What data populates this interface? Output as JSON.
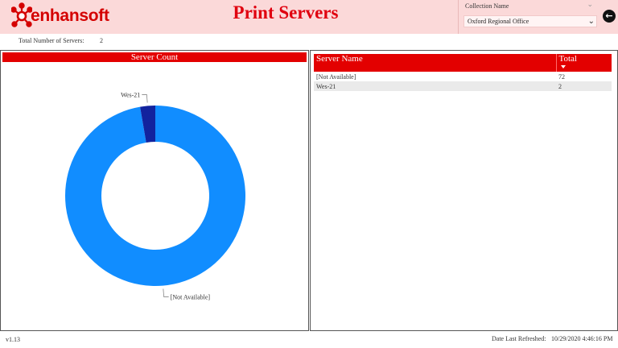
{
  "header": {
    "logo_text": "enhansoft",
    "title": "Print Servers",
    "brand_color": "#e30000"
  },
  "slicer": {
    "label": "Collection Name",
    "value": "Oxford Regional Office",
    "chevron_icon": "chevron-down-icon"
  },
  "back_button": {
    "icon": "arrow-left-icon"
  },
  "summary": {
    "total_label": "Total Number of Servers:",
    "total_value": "2"
  },
  "chart_data": {
    "type": "pie",
    "title": "Server Count",
    "labels": [
      "[Not Available]",
      "Wes-21"
    ],
    "values": [
      72,
      2
    ],
    "colors": [
      "#118dff",
      "#12239e"
    ],
    "donut": true
  },
  "table": {
    "columns": [
      "Server Name",
      "Total"
    ],
    "rows": [
      [
        "[Not Available]",
        "72"
      ],
      [
        "Wes-21",
        "2"
      ]
    ]
  },
  "footer": {
    "version": "v1.13",
    "refreshed_label": "Date Last Refreshed:",
    "refreshed_value": "10/29/2020 4:46:16 PM"
  }
}
